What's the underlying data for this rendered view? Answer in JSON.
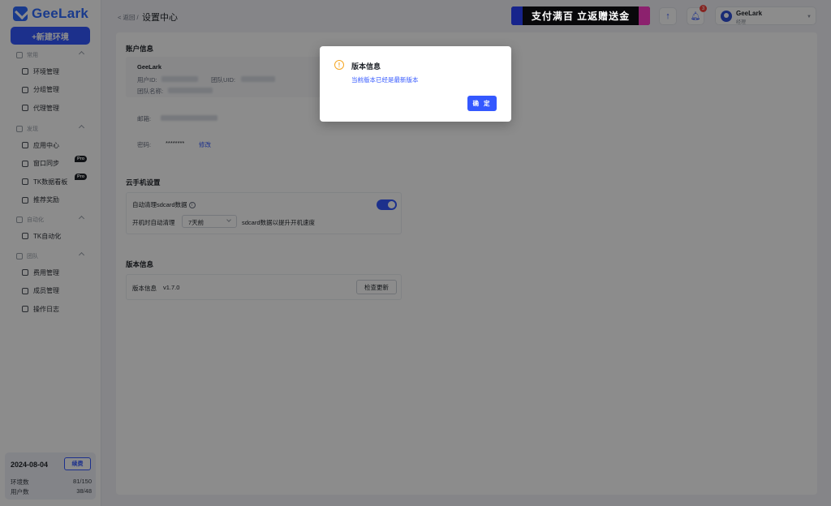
{
  "app": {
    "name": "GeeLark"
  },
  "sidebar": {
    "new_env_label": "+新建环境",
    "groups": [
      {
        "label": "常用",
        "items": [
          {
            "label": "环境管理"
          },
          {
            "label": "分组管理"
          },
          {
            "label": "代理管理"
          }
        ]
      },
      {
        "label": "发现",
        "items": [
          {
            "label": "应用中心"
          },
          {
            "label": "窗口同步",
            "badge": "Pro"
          },
          {
            "label": "TK数据看板",
            "badge": "Pro"
          },
          {
            "label": "推荐奖励"
          }
        ]
      },
      {
        "label": "自动化",
        "items": [
          {
            "label": "TK自动化"
          }
        ]
      },
      {
        "label": "团队",
        "items": [
          {
            "label": "费用管理"
          },
          {
            "label": "成员管理"
          },
          {
            "label": "操作日志"
          }
        ]
      }
    ],
    "footer": {
      "date": "2024-08-04",
      "renew_label": "续费",
      "env_label": "环境数",
      "env_value": "81/150",
      "user_label": "用户数",
      "user_value": "38/48"
    }
  },
  "header": {
    "back_label": "< 返回 /",
    "title": "设置中心",
    "banner_text": "支付满百 立返赠送金",
    "notification_count": "3",
    "user_name": "GeeLark",
    "user_role": "经理"
  },
  "account": {
    "section_title": "账户信息",
    "name": "GeeLark",
    "user_id_label": "用户ID:",
    "team_uid_label": "团队UID:",
    "team_name_label": "团队名称:",
    "email_label": "邮箱:",
    "password_label": "密码:",
    "password_value": "********",
    "modify_label": "修改"
  },
  "cloud": {
    "section_title": "云手机设置",
    "auto_clean_label": "自动清理sdcard数据",
    "auto_clean_on": true,
    "boot_clean_label": "开机时自动清理",
    "select_value": "7天前",
    "boot_clean_suffix": "sdcard数据以提升开机速度"
  },
  "version": {
    "section_title": "版本信息",
    "label": "版本信息",
    "value": "v1.7.0",
    "check_label": "检查更新"
  },
  "modal": {
    "title": "版本信息",
    "message": "当前版本已经是最新版本",
    "ok_label": "确 定"
  },
  "colors": {
    "accent": "#3458ff",
    "warning": "#f5a623",
    "badge": "#f5423d"
  }
}
